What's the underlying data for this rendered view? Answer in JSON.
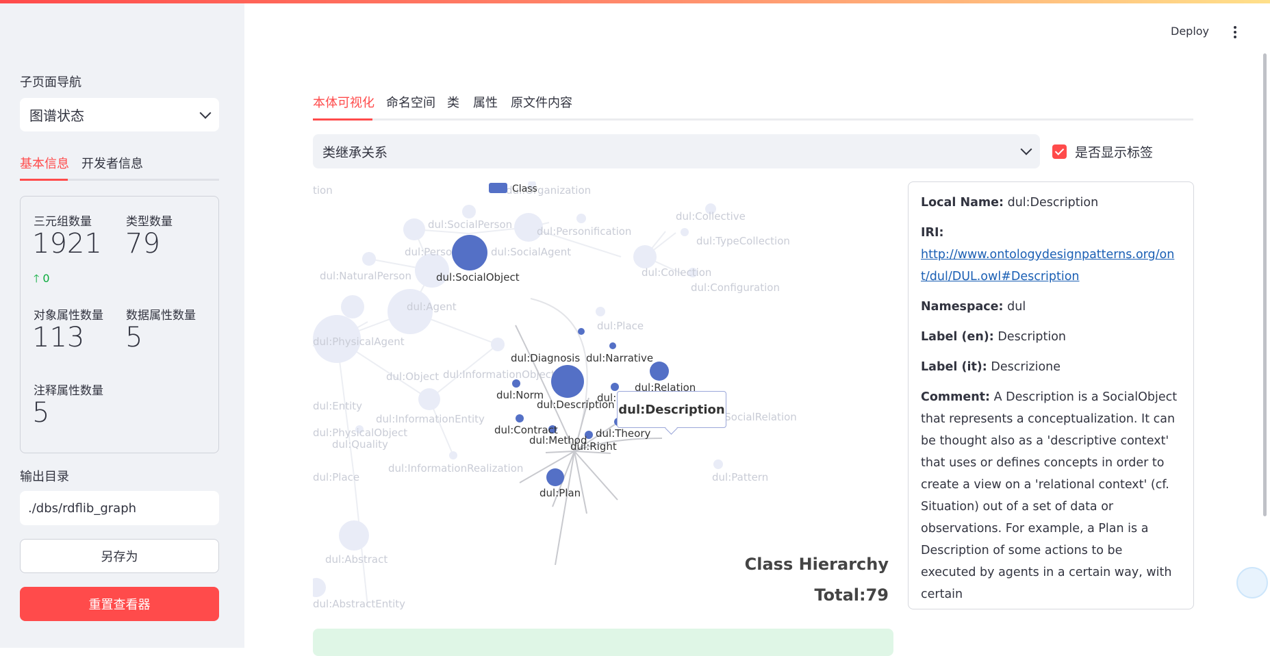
{
  "sidebar": {
    "nav_label": "子页面导航",
    "nav_selected": "图谱状态",
    "tabs": [
      "基本信息",
      "开发者信息"
    ],
    "metrics": [
      {
        "label": "三元组数量",
        "value": "1921",
        "delta": "0"
      },
      {
        "label": "类型数量",
        "value": "79"
      },
      {
        "label": "对象属性数量",
        "value": "113"
      },
      {
        "label": "数据属性数量",
        "value": "5"
      },
      {
        "label": "注释属性数量",
        "value": "5"
      }
    ],
    "output_label": "输出目录",
    "output_value": "./dbs/rdflib_graph",
    "save_as": "另存为",
    "reset": "重置查看器"
  },
  "header": {
    "deploy": "Deploy"
  },
  "main": {
    "tabs": [
      "本体可视化",
      "命名空间",
      "类",
      "属性",
      "原文件内容"
    ],
    "graph_select": "类继承关系",
    "show_labels": "是否显示标签",
    "legend": "Class",
    "tooltip": "dul:Description",
    "hier_title": "Class Hierarchy",
    "hier_total": "Total:79",
    "colors": {
      "node": "#5470c6",
      "faded": "#e9ecf7",
      "accent": "#ff4b4b"
    }
  },
  "detail": {
    "local_name_key": "Local Name:",
    "local_name": "dul:Description",
    "iri_key": "IRI:",
    "iri": "http://www.ontologydesignpatterns.org/ont/dul/DUL.owl#Description",
    "namespace_key": "Namespace:",
    "namespace": "dul",
    "label_en_key": "Label (en):",
    "label_en": "Description",
    "label_it_key": "Label (it):",
    "label_it": "Descrizione",
    "comment_key": "Comment:",
    "comment": "A Description is a SocialObject that represents a conceptualization. It can be thought also as a 'descriptive context' that uses or defines concepts in order to create a view on a 'relational context' (cf. Situation) out of a set of data or observations. For example, a Plan is a Description of some actions to be executed by agents in a certain way, with certain"
  },
  "graph": {
    "active_nodes": [
      {
        "name": "dul:SocialObject"
      },
      {
        "name": "dul:Description"
      },
      {
        "name": "dul:Norm"
      },
      {
        "name": "dul:Goal"
      },
      {
        "name": "dul:Relation"
      },
      {
        "name": "dul:Contract"
      },
      {
        "name": "dul:Method"
      },
      {
        "name": "dul:Right"
      },
      {
        "name": "dul:Theory"
      },
      {
        "name": "dul:Plan"
      },
      {
        "name": "dul:Diagnosis"
      },
      {
        "name": "dul:Narrative"
      }
    ],
    "faded_nodes": [
      {
        "name": "dul:Organization"
      },
      {
        "name": "dul:SocialPerson"
      },
      {
        "name": "dul:Person"
      },
      {
        "name": "dul:SocialAgent"
      },
      {
        "name": "dul:Personification"
      },
      {
        "name": "dul:Collective"
      },
      {
        "name": "dul:TypeCollection"
      },
      {
        "name": "dul:NaturalPerson"
      },
      {
        "name": "dul:Agent"
      },
      {
        "name": "dul:Collection"
      },
      {
        "name": "dul:Configuration"
      },
      {
        "name": "dul:PhysicalAgent"
      },
      {
        "name": "dul:Place"
      },
      {
        "name": "dul:Object"
      },
      {
        "name": "dul:InformationObject"
      },
      {
        "name": "dul:Entity"
      },
      {
        "name": "dul:InformationEntity"
      },
      {
        "name": "dul:Quality"
      },
      {
        "name": "dul:InformationRealization"
      },
      {
        "name": "dul:SocialRelation"
      },
      {
        "name": "dul:Pattern"
      },
      {
        "name": "dul:Abstract"
      },
      {
        "name": "dul:Place"
      },
      {
        "name": "dul:PhysicalObject"
      },
      {
        "name": "dul:Action"
      },
      {
        "name": "dul:AbstractEntity"
      }
    ]
  }
}
